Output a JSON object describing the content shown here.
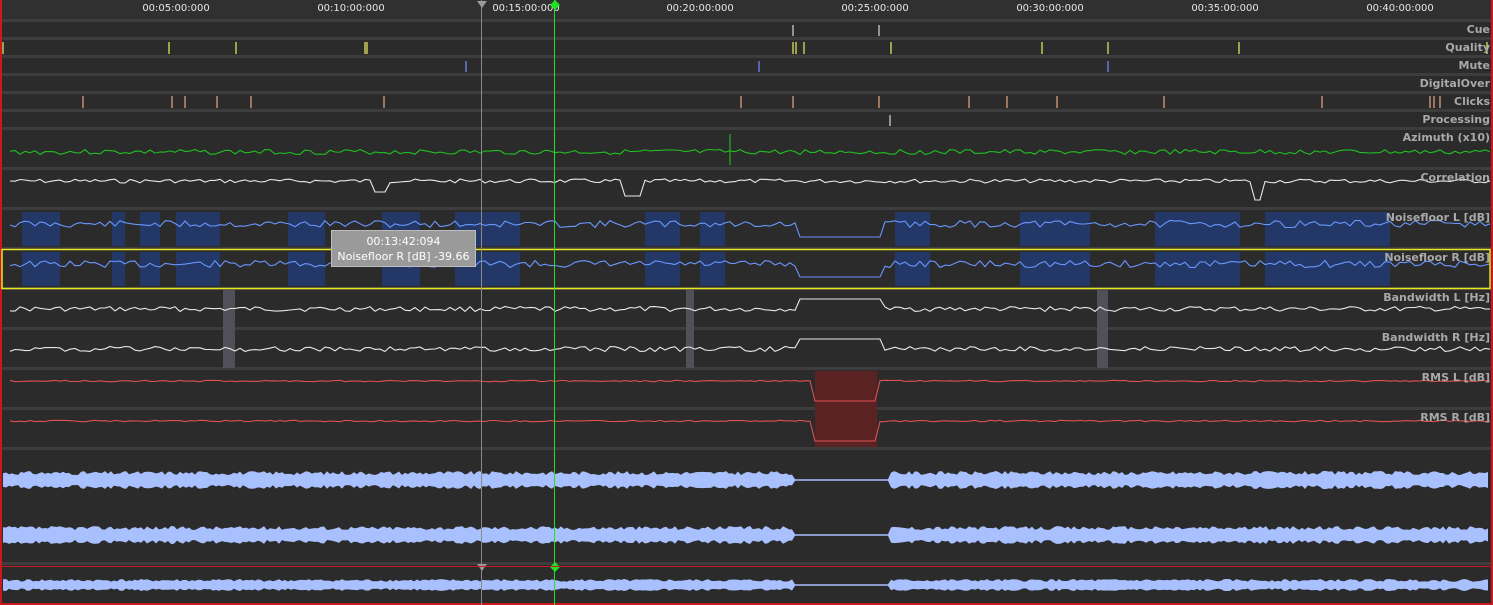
{
  "ruler": {
    "ticks": [
      "00:05:00:000",
      "00:10:00:000",
      "00:15:00:000",
      "00:20:00:000",
      "00:25:00:000",
      "00:30:00:000",
      "00:35:00:000",
      "00:40:00:000"
    ]
  },
  "rows": {
    "cue": "Cue",
    "quality": "Quality",
    "mute": "Mute",
    "digital_over": "DigitalOver",
    "clicks": "Clicks",
    "processing": "Processing",
    "azimuth": "Azimuth (x10)",
    "correlation": "Correlation",
    "noisefloor_l": "Noisefloor L [dB]",
    "noisefloor_r": "Noisefloor R [dB]",
    "bandwidth_l": "Bandwidth L [Hz]",
    "bandwidth_r": "Bandwidth R [Hz]",
    "rms_l": "RMS L [dB]",
    "rms_r": "RMS R [dB]"
  },
  "tooltip": {
    "time": "00:13:42:094",
    "value": "Noisefloor R [dB] -39.66"
  },
  "colors": {
    "frame": "#c8191e",
    "playhead": "#22e022",
    "hover_cursor": "#9a9a9a",
    "quality": "#f0f060",
    "mute": "#6f8fff",
    "clicks": "#e8a888",
    "azimuth": "#20c020",
    "noisefloor": "#6a96ff",
    "rms": "#e05050",
    "waveform": "#a9c0ff",
    "selected_row": "#e8e820"
  },
  "icons": {
    "hover_marker": "triangle-down-icon",
    "playhead_marker": "playhead-diamond-icon"
  }
}
